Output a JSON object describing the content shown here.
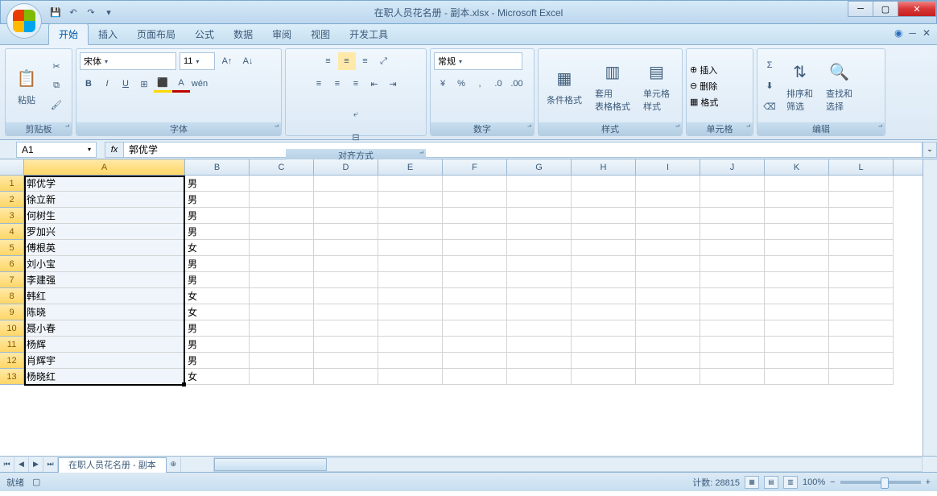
{
  "title": "在职人员花名册 - 副本.xlsx - Microsoft Excel",
  "tabs": [
    "开始",
    "插入",
    "页面布局",
    "公式",
    "数据",
    "审阅",
    "视图",
    "开发工具"
  ],
  "ribbon": {
    "clipboard": {
      "label": "剪贴板",
      "paste": "粘贴"
    },
    "font": {
      "label": "字体",
      "name": "宋体",
      "size": "11"
    },
    "align": {
      "label": "对齐方式"
    },
    "number": {
      "label": "数字",
      "format": "常规"
    },
    "styles": {
      "label": "样式",
      "cond": "条件格式",
      "table": "套用\n表格格式",
      "cell": "单元格\n样式"
    },
    "cells": {
      "label": "单元格",
      "insert": "插入",
      "delete": "删除",
      "format": "格式"
    },
    "editing": {
      "label": "编辑",
      "sort": "排序和\n筛选",
      "find": "查找和\n选择"
    }
  },
  "nameBox": "A1",
  "formula": "郭优学",
  "columns": [
    "A",
    "B",
    "C",
    "D",
    "E",
    "F",
    "G",
    "H",
    "I",
    "J",
    "K",
    "L"
  ],
  "rows": [
    {
      "n": "1",
      "a": "郭优学",
      "b": "男"
    },
    {
      "n": "2",
      "a": "徐立新",
      "b": "男"
    },
    {
      "n": "3",
      "a": "何树生",
      "b": "男"
    },
    {
      "n": "4",
      "a": "罗加兴",
      "b": "男"
    },
    {
      "n": "5",
      "a": "傅根英",
      "b": "女"
    },
    {
      "n": "6",
      "a": "刘小宝",
      "b": "男"
    },
    {
      "n": "7",
      "a": "李建强",
      "b": "男"
    },
    {
      "n": "8",
      "a": "韩红",
      "b": "女"
    },
    {
      "n": "9",
      "a": "陈晓",
      "b": "女"
    },
    {
      "n": "10",
      "a": "聂小春",
      "b": "男"
    },
    {
      "n": "11",
      "a": "杨辉",
      "b": "男"
    },
    {
      "n": "12",
      "a": "肖辉宇",
      "b": "男"
    },
    {
      "n": "13",
      "a": "杨晓红",
      "b": "女"
    }
  ],
  "sheetName": "在职人员花名册 - 副本",
  "status": {
    "ready": "就绪",
    "count": "计数: 28815",
    "zoom": "100%"
  }
}
